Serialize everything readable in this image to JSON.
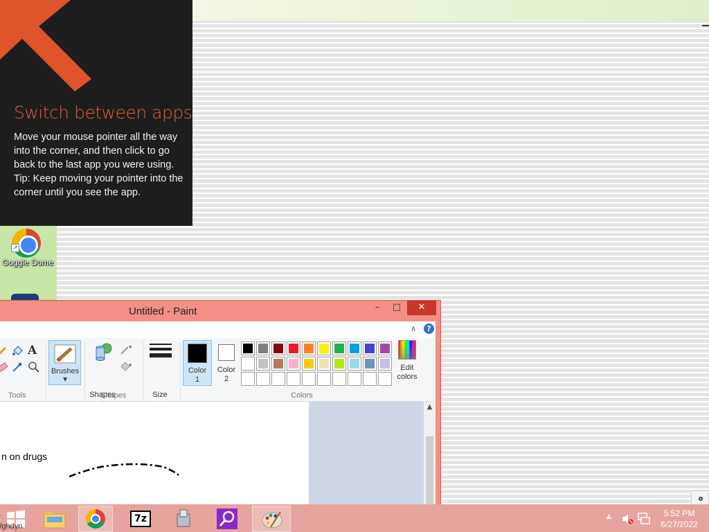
{
  "tip": {
    "title": "Switch between apps",
    "body": "Move your mouse pointer all the way into the corner, and then click to go back to the last app you were using.",
    "tip": "Tip: Keep moving your pointer into the corner until you see the app."
  },
  "desktop": {
    "icons": [
      {
        "label": "Goggle Dome",
        "icon": "chrome-icon"
      }
    ],
    "partial_label": "lghdyn"
  },
  "paint": {
    "title": "Untitled - Paint",
    "controls": {
      "minimize": "–",
      "maximize": "□",
      "close": "✕"
    },
    "help": "?",
    "collapse": "∧",
    "groups": {
      "tools": "Tools",
      "shapes": "Shapes",
      "colors": "Colors"
    },
    "buttons": {
      "brushes": "Brushes",
      "shapes": "Shapes",
      "size": "Size",
      "color1_a": "Color",
      "color1_b": "1",
      "color2_a": "Color",
      "color2_b": "2",
      "edit_colors_a": "Edit",
      "edit_colors_b": "colors"
    },
    "color1": "#000000",
    "color2": "#ffffff",
    "palette": [
      [
        "#000000",
        "#7f7f7f",
        "#880015",
        "#ed1c24",
        "#ff7f27",
        "#fff200",
        "#22b14c",
        "#00a2e8",
        "#3f48cc",
        "#a349a4"
      ],
      [
        "#ffffff",
        "#c3c3c3",
        "#b97a57",
        "#ffaec9",
        "#ffc90e",
        "#efe4b0",
        "#b5e61d",
        "#99d9ea",
        "#7092be",
        "#c8bfe7"
      ],
      [
        "",
        "",
        "",
        "",
        "",
        "",
        "",
        "",
        "",
        ""
      ]
    ],
    "canvas_text": "n on drugs"
  },
  "taskbar": {
    "time": "5:52 PM",
    "date": "6/27/2022",
    "apps": [
      "file-explorer",
      "chrome",
      "7zip",
      "app-installer",
      "search-app",
      "paint"
    ]
  }
}
